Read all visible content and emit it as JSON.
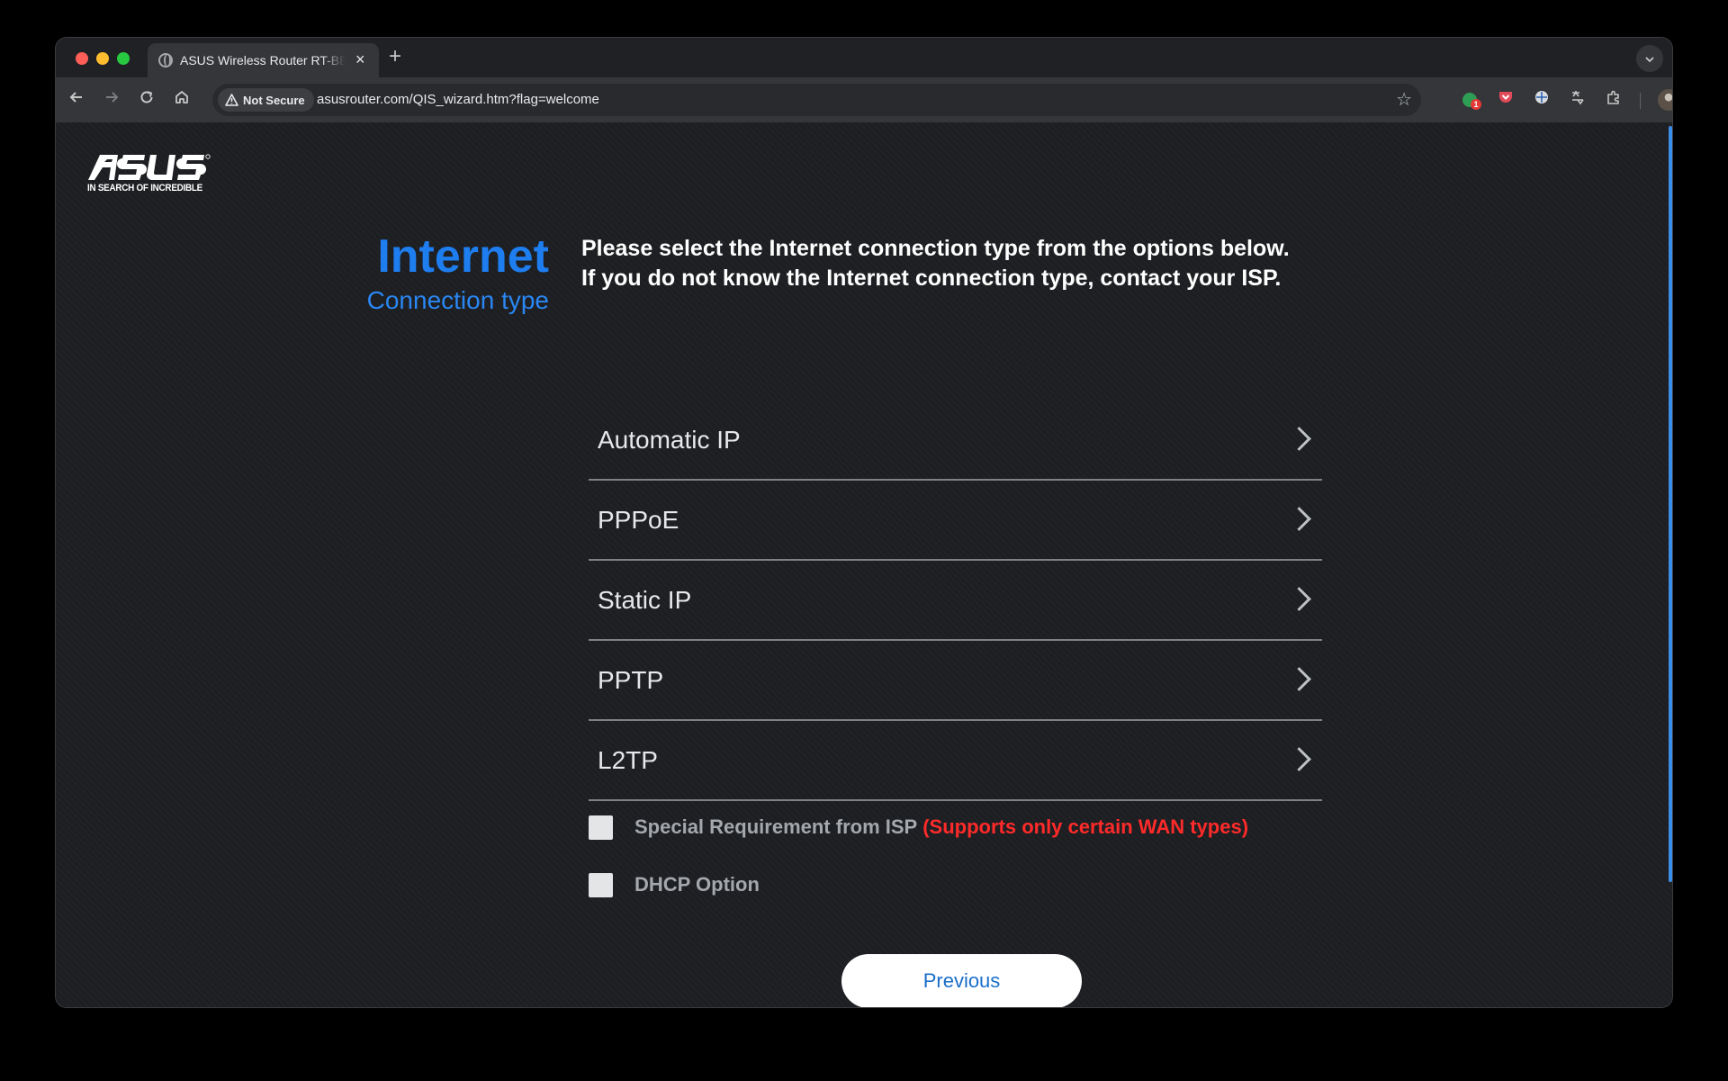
{
  "browser": {
    "tab_title": "ASUS Wireless Router RT-BE",
    "tab_close": "×",
    "new_tab": "+",
    "security_label": "Not Secure",
    "url": "asusrouter.com/QIS_wizard.htm?flag=welcome",
    "extension_badge": "1",
    "icons": {
      "back": "arrow-left",
      "forward": "arrow-right",
      "reload": "reload",
      "home": "home",
      "warning": "warning-triangle",
      "bookmark": "star",
      "menu": "three-dots"
    }
  },
  "page": {
    "logo_text": "ASUS",
    "logo_tagline": "IN SEARCH OF INCREDIBLE",
    "heading_title": "Internet",
    "heading_subtitle": "Connection type",
    "instruction": "Please select the Internet connection type from the options below. If you do not know the Internet connection type, contact your ISP.",
    "options": [
      {
        "label": "Automatic IP"
      },
      {
        "label": "PPPoE"
      },
      {
        "label": "Static IP"
      },
      {
        "label": "PPTP"
      },
      {
        "label": "L2TP"
      }
    ],
    "checkboxes": {
      "special_requirement": {
        "label": "Special Requirement from ISP",
        "note": "(Supports only certain WAN types)",
        "checked": false
      },
      "dhcp_option": {
        "label": "DHCP Option",
        "checked": false
      }
    },
    "previous_label": "Previous"
  },
  "colors": {
    "accent_blue": "#1e7ef0",
    "warning_red": "#ff2a2a",
    "page_bg": "#1c1e21",
    "button_text": "#1a6fc9"
  }
}
